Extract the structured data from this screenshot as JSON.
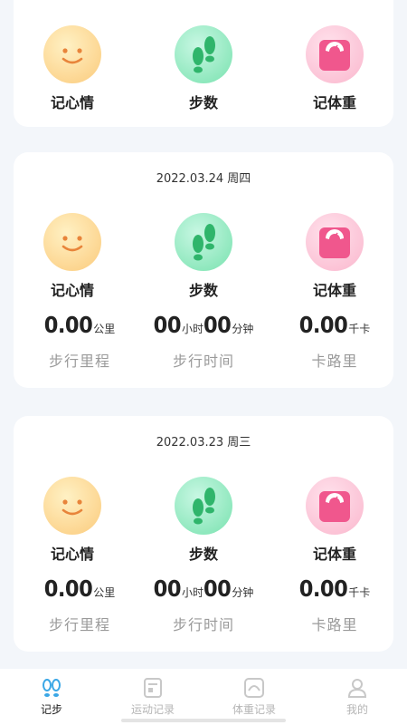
{
  "icon_labels": {
    "mood": "记心情",
    "steps": "步数",
    "weight": "记体重"
  },
  "icons": {
    "mood": "smiley-face-icon",
    "steps": "footprints-icon",
    "weight": "scale-icon"
  },
  "days": [
    {
      "date": "2022.03.24 周四",
      "distance": {
        "value": "0.00",
        "unit": "公里",
        "label": "步行里程"
      },
      "time": {
        "hours": "00",
        "hours_unit": "小时",
        "minutes": "00",
        "minutes_unit": "分钟",
        "label": "步行时间"
      },
      "calories": {
        "value": "0.00",
        "unit": "千卡",
        "label": "卡路里"
      }
    },
    {
      "date": "2022.03.23 周三",
      "distance": {
        "value": "0.00",
        "unit": "公里",
        "label": "步行里程"
      },
      "time": {
        "hours": "00",
        "hours_unit": "小时",
        "minutes": "00",
        "minutes_unit": "分钟",
        "label": "步行时间"
      },
      "calories": {
        "value": "0.00",
        "unit": "千卡",
        "label": "卡路里"
      }
    }
  ],
  "tabs": [
    {
      "label": "记步",
      "icon": "footprints-icon",
      "active": true
    },
    {
      "label": "运动记录",
      "icon": "record-icon",
      "active": false
    },
    {
      "label": "体重记录",
      "icon": "scale-icon",
      "active": false
    },
    {
      "label": "我的",
      "icon": "user-icon",
      "active": false
    }
  ],
  "colors": {
    "accent": "#3aa7e6",
    "weight_icon": "#f0578d",
    "steps_icon": "#2fb56b",
    "mood_face": "#e8843a"
  }
}
